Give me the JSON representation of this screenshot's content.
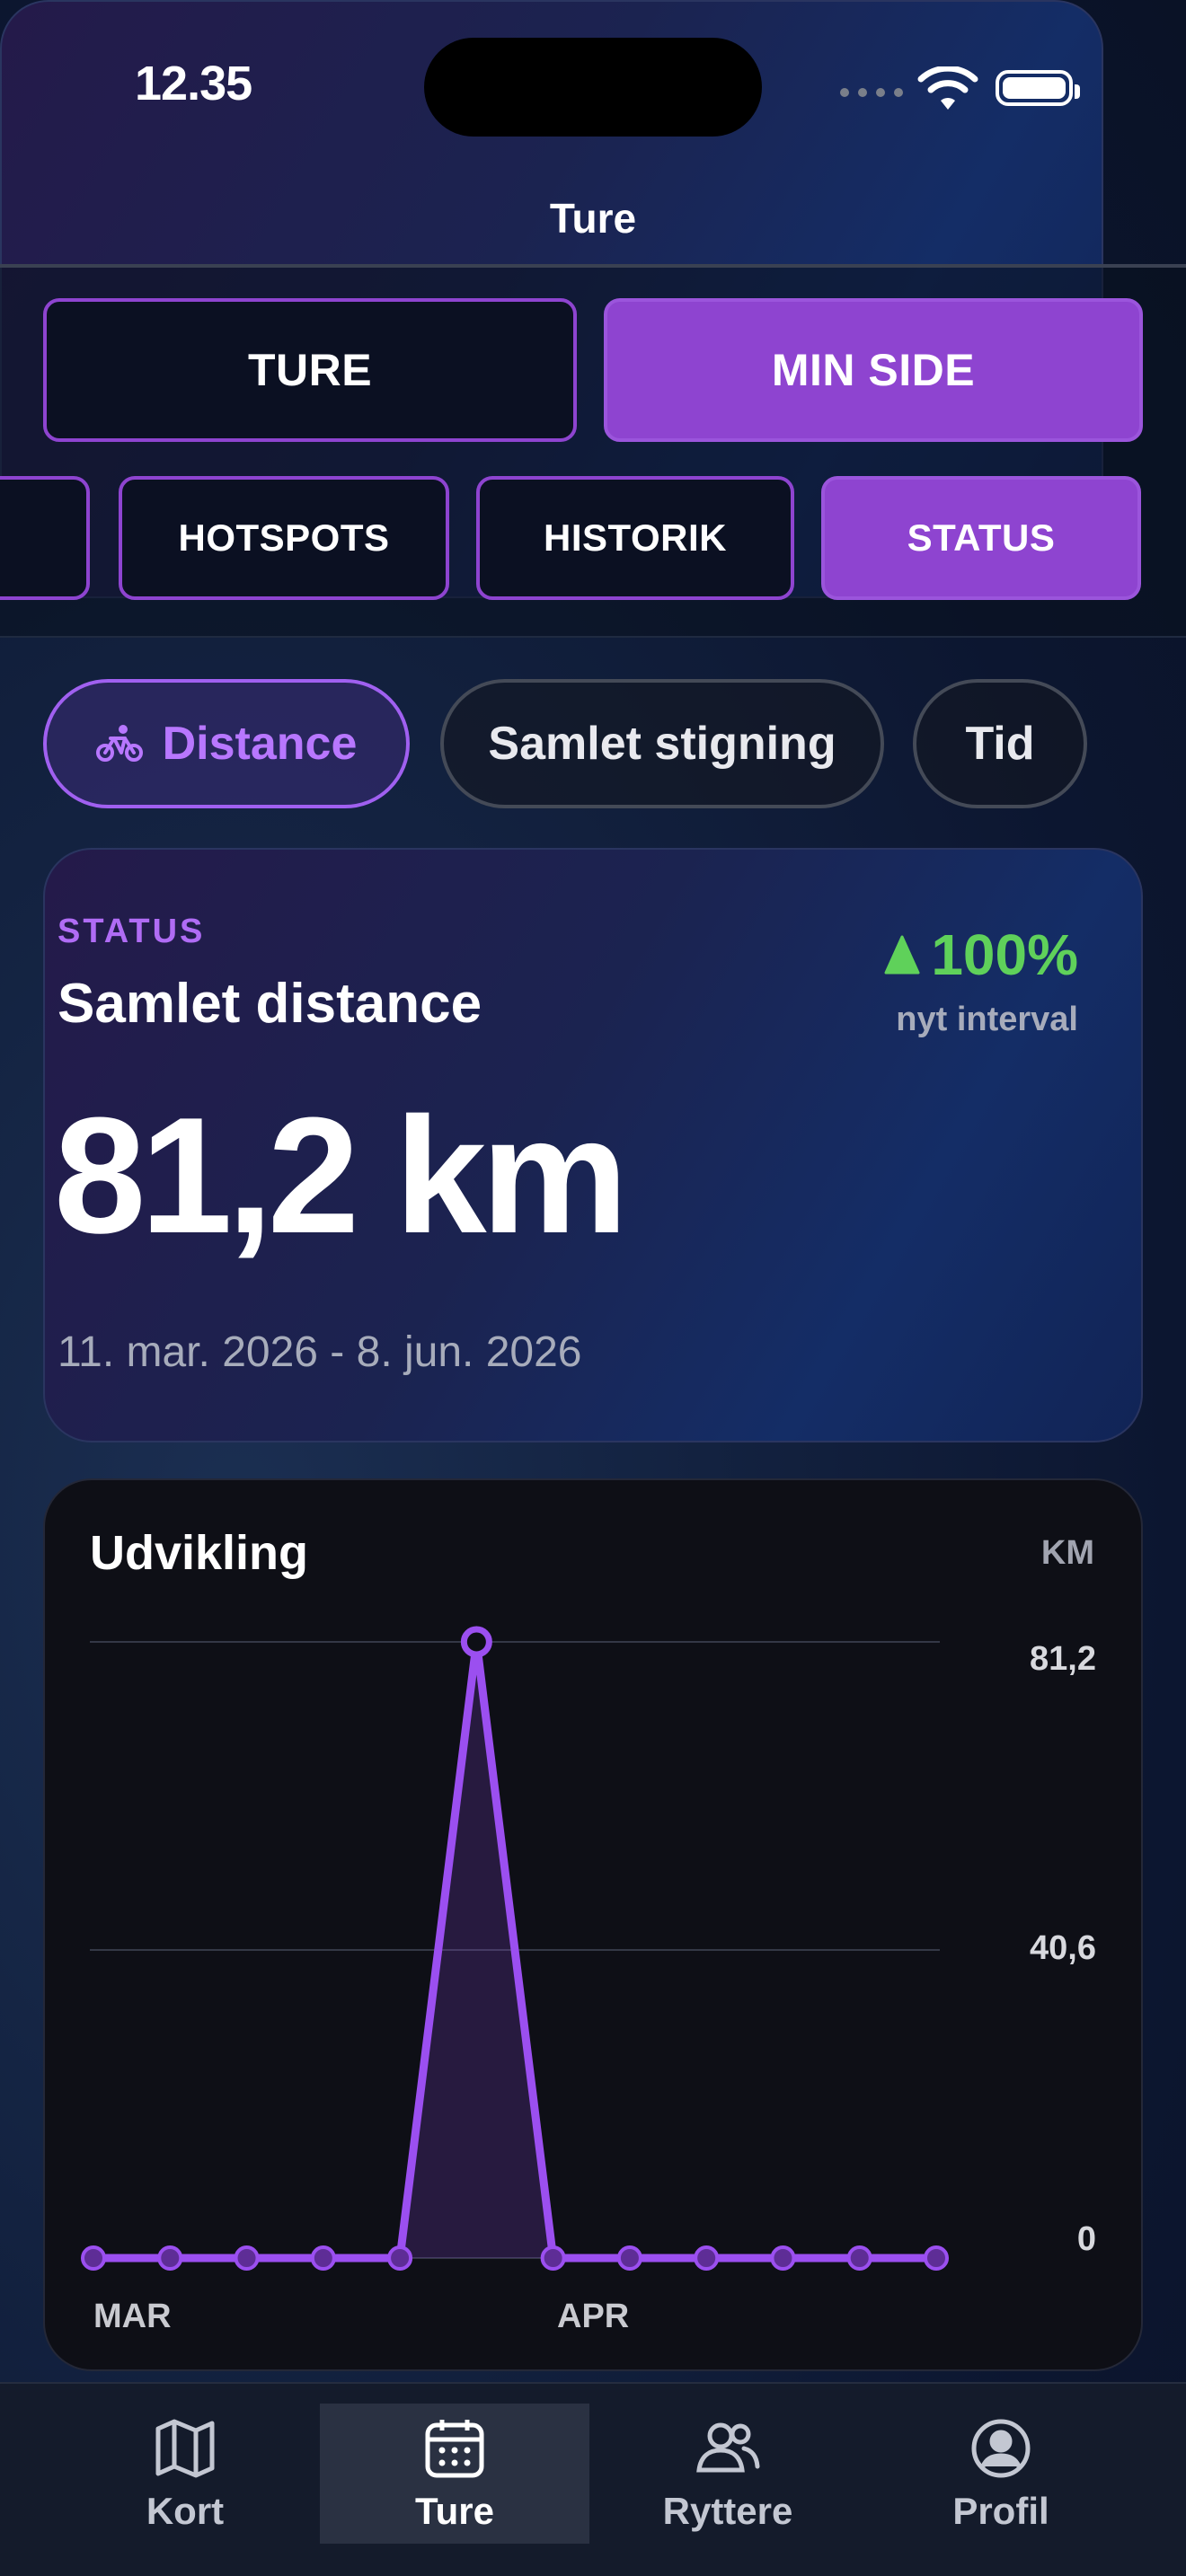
{
  "status_bar": {
    "time": "12.35"
  },
  "nav": {
    "title": "Ture"
  },
  "segments": {
    "primary": [
      {
        "label": "TURE",
        "active": false
      },
      {
        "label": "MIN SIDE",
        "active": true
      }
    ],
    "secondary": [
      {
        "label": "HOTSPOTS",
        "active": false
      },
      {
        "label": "HISTORIK",
        "active": false
      },
      {
        "label": "STATUS",
        "active": true
      }
    ]
  },
  "chips": [
    {
      "label": "Distance",
      "icon": "bicycle-icon",
      "active": true
    },
    {
      "label": "Samlet stigning",
      "active": false
    },
    {
      "label": "Tid",
      "active": false
    }
  ],
  "status_card": {
    "label": "STATUS",
    "heading": "Samlet distance",
    "value": "81,2 km",
    "range": "11. mar. 2026 - 8. jun. 2026",
    "trend": "100%",
    "trend_sub": "nyt interval"
  },
  "chart_card": {
    "title": "Udvikling",
    "unit": "KM"
  },
  "chart_data": {
    "type": "line",
    "x": [
      "",
      "",
      "",
      "",
      "",
      "",
      "",
      "",
      "",
      "",
      "",
      ""
    ],
    "x_tick_labels": [
      "MAR",
      "APR"
    ],
    "y_tick_labels": [
      "81,2",
      "40,6",
      "0"
    ],
    "series": [
      {
        "values": [
          0,
          0,
          0,
          0,
          0,
          81.2,
          0,
          0,
          0,
          0,
          0,
          0
        ]
      }
    ],
    "ylim": [
      0,
      81.2
    ],
    "grid": true,
    "color": "#9b4ff0"
  },
  "tabbar": [
    {
      "label": "Kort",
      "icon": "map-icon",
      "active": false
    },
    {
      "label": "Ture",
      "icon": "calendar-icon",
      "active": true
    },
    {
      "label": "Ryttere",
      "icon": "users-icon",
      "active": false
    },
    {
      "label": "Profil",
      "icon": "profile-icon",
      "active": false
    }
  ],
  "colors": {
    "accent": "#8e44d0",
    "positive": "#5fd15a",
    "background": "#0c1630"
  }
}
